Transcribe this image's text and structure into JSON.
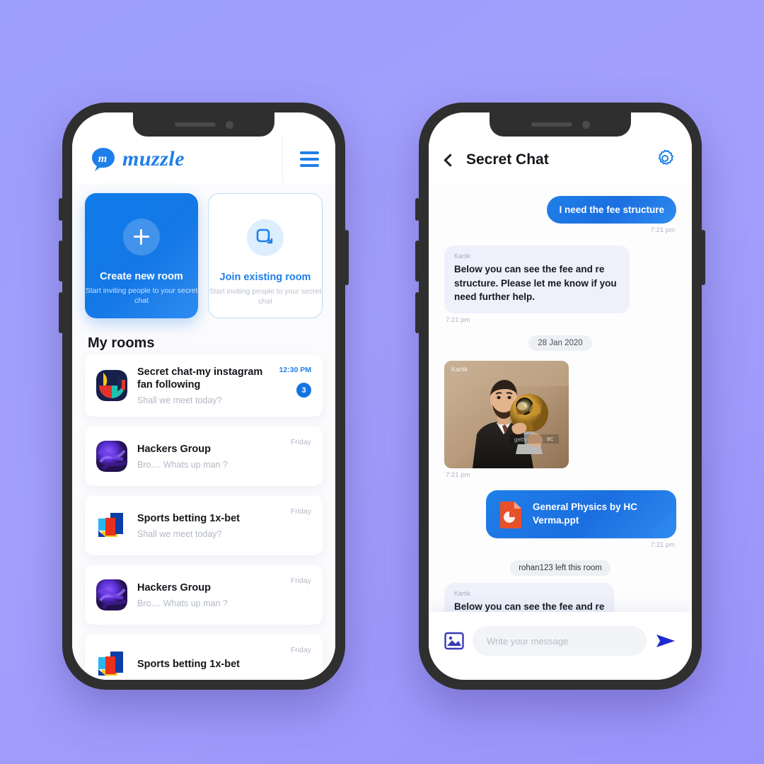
{
  "background": {
    "color_top": "#9d9dfc",
    "color_bottom": "#9a93fb"
  },
  "left_phone": {
    "header": {
      "logo_text": "muzzle",
      "logo_icon": "muzzle-speech-bubble-logo",
      "menu_icon": "hamburger-menu-icon"
    },
    "cards": [
      {
        "title": "Create new room",
        "subtitle": "Start inviting people to your secret chat",
        "icon": "plus-icon",
        "style": "filled"
      },
      {
        "title": "Join existing room",
        "subtitle": "Start inviting people to your secret chat",
        "icon": "join-room-icon",
        "style": "outline"
      }
    ],
    "rooms_heading": "My rooms",
    "rooms": [
      {
        "name": "Secret chat-my instagram fan following",
        "message": "Shall we meet today?",
        "time": "12:30 PM",
        "time_accent": true,
        "unread": "3",
        "avatar": "avatar-geometric-multicolor"
      },
      {
        "name": "Hackers Group",
        "message": "Bro.... Whats up man ?",
        "time": "Friday",
        "time_accent": false,
        "unread": "",
        "avatar": "avatar-purple-swirl"
      },
      {
        "name": "Sports betting 1x-bet",
        "message": "Shall we meet today?",
        "time": "Friday",
        "time_accent": false,
        "unread": "",
        "avatar": "avatar-blue-red-blocks"
      },
      {
        "name": "Hackers Group",
        "message": "Bro.... Whats up man ?",
        "time": "Friday",
        "time_accent": false,
        "unread": "",
        "avatar": "avatar-purple-swirl"
      },
      {
        "name": "Sports betting 1x-bet",
        "message": "",
        "time": "Friday",
        "time_accent": false,
        "unread": "",
        "avatar": "avatar-blue-red-blocks"
      }
    ]
  },
  "right_phone": {
    "header": {
      "title": "Secret Chat",
      "back_icon": "back-chevron-icon",
      "settings_icon": "gear-icon"
    },
    "messages": [
      {
        "kind": "out-text",
        "text": "I need the fee structure",
        "time": "7:21 pm"
      },
      {
        "kind": "in-text",
        "sender": "Kartik",
        "text": "Below you can see the fee and re structure. Please let me know if you need further help.",
        "time": "7:21 pm"
      },
      {
        "kind": "date",
        "text": "28 Jan 2020"
      },
      {
        "kind": "in-photo",
        "sender": "Kartik",
        "time": "7:21 pm",
        "alt": "man-holding-golden-trophy"
      },
      {
        "kind": "out-file",
        "file_name": "General Physics by HC Verma.ppt",
        "file_icon": "powerpoint-file-icon",
        "time": "7:21 pm"
      },
      {
        "kind": "system",
        "text": "rohan123 left this room"
      },
      {
        "kind": "in-text",
        "sender": "Kartik",
        "text": "Below you can see the fee and re",
        "time": ""
      }
    ],
    "composer": {
      "image_icon": "image-attach-icon",
      "placeholder": "Write your message",
      "value": "",
      "send_icon": "send-arrow-icon"
    }
  },
  "colors": {
    "accent_blue": "#1f7fe8",
    "bubble_in": "#eef0fb",
    "badge": "#1274e4"
  }
}
